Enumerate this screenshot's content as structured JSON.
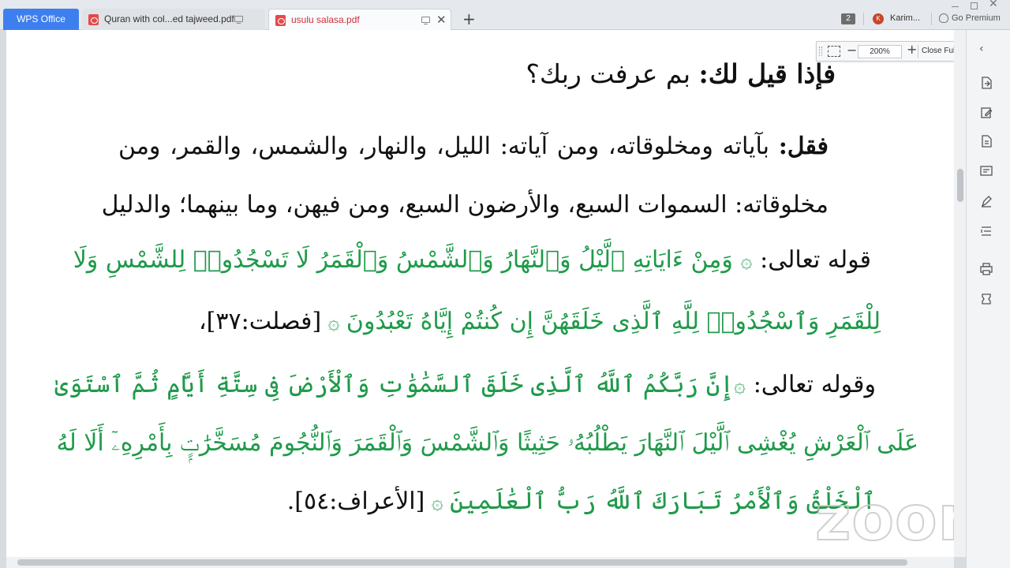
{
  "tabs": {
    "brand": "WPS Office",
    "items": [
      {
        "title": "Quran with col...ed tajweed.pdf"
      },
      {
        "title": "usulu salasa.pdf"
      }
    ],
    "new_tab": "+"
  },
  "account": {
    "notification_count": "2",
    "avatar_initial": "K",
    "user_name": "Karim...",
    "premium": "Go Premium"
  },
  "zoombar": {
    "zoom_value": "200%",
    "minus": "−",
    "plus": "+",
    "close_full_screen": "Close Full Screen"
  },
  "document": {
    "question": {
      "bold": "فإذا قيل لك:",
      "rest": " بم عرفت ربك؟"
    },
    "line1": {
      "bold": "فقل:",
      "rest": " بآياته ومخلوقاته، ومن آياته: الليل، والنهار، والشمس، والقمر، ومن"
    },
    "line2": "مخلوقاته: السموات السبع، والأرضون السبع، ومن فيهن، وما بينهما؛ والدليل",
    "line3": {
      "black": "قوله تعالى: ",
      "orn": "۞",
      "green": " وَمِنْ ءَايَاتِهِ ٱلَّيْلُ وَٱلنَّهَارُ وَٱلشَّمْسُ وَٱلْقَمَرُ لَا تَسْجُدُوا۟ لِلشَّمْسِ وَلَا"
    },
    "line4": {
      "green": "لِلْقَمَرِ وَٱسْجُدُوا۟ لِلَّهِ ٱلَّذِى خَلَقَهُنَّ إِن كُنتُمْ إِيَّاهُ تَعْبُدُونَ",
      "orn": " ۞ ",
      "black": "[فصلت:٣٧]،"
    },
    "line5": {
      "black": "وقوله تعالى: ",
      "orn": "۞",
      "green": "إِنَّ رَبَّكُمُ ٱللَّهُ ٱلَّذِى خَلَقَ ٱلسَّمَٰوَٰتِ وَٱلْأَرْضَ فِى سِتَّةِ أَيَّامٍ ثُمَّ ٱسْتَوَىٰ"
    },
    "line6": "عَلَى ٱلْعَرْشِ يُغْشِى ٱلَّيْلَ ٱلنَّهَارَ يَطْلُبُهُۥ حَثِيثًا وَٱلشَّمْسَ وَٱلْقَمَرَ وَٱلنُّجُومَ مُسَخَّرَٰتٍۭ بِأَمْرِهِۦٓ أَلَا لَهُ",
    "line7": {
      "green": "ٱلْخَلْقُ وَٱلْأَمْرُ تَبَارَكَ ٱللَّهُ رَبُّ ٱلْعَٰلَمِينَ",
      "orn": " ۞ ",
      "black": "[الأعراف:٥٤]."
    }
  },
  "watermark": "zoom",
  "colors": {
    "brand": "#3d7fef",
    "quran_green": "#1f9a4a",
    "active_tab_text": "#d0303a"
  }
}
